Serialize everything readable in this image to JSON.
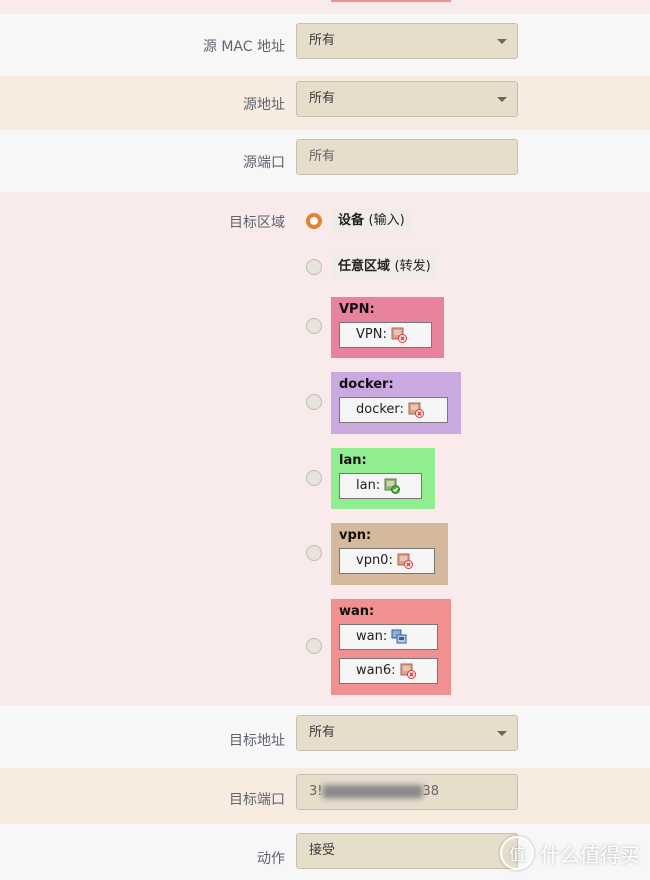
{
  "form": {
    "src_mac": {
      "label": "源 MAC 地址",
      "value": "所有"
    },
    "src_addr": {
      "label": "源地址",
      "value": "所有"
    },
    "src_port": {
      "label": "源端口",
      "placeholder": "所有"
    },
    "dest_zone": {
      "label": "目标区域",
      "device": {
        "name": "设备",
        "sub": "(输入)",
        "checked": true
      },
      "any": {
        "name": "任意区域",
        "sub": "(转发)"
      },
      "zones": [
        {
          "name": "VPN:",
          "color": "#e8839e",
          "ifaces": [
            {
              "name": "VPN:",
              "status": "down"
            }
          ]
        },
        {
          "name": "docker:",
          "color": "#c9a9df",
          "ifaces": [
            {
              "name": "docker:",
              "status": "down"
            }
          ]
        },
        {
          "name": "lan:",
          "color": "#90ee90",
          "ifaces": [
            {
              "name": "lan:",
              "status": "up"
            }
          ]
        },
        {
          "name": "vpn:",
          "color": "#d5b99c",
          "ifaces": [
            {
              "name": "vpn0:",
              "status": "down"
            }
          ]
        },
        {
          "name": "wan:",
          "color": "#f09090",
          "ifaces": [
            {
              "name": "wan:",
              "status": "multi"
            },
            {
              "name": "wan6:",
              "status": "down"
            }
          ]
        }
      ]
    },
    "dest_addr": {
      "label": "目标地址",
      "value": "所有"
    },
    "dest_port": {
      "label": "目标端口",
      "value_start": "3!",
      "value_blur": "▇▇▇▇▇▇▇▇▇▇",
      "value_end": "38"
    },
    "action": {
      "label": "动作",
      "value": "接受"
    }
  },
  "watermark": {
    "text": "什么值得买",
    "logo": "值"
  }
}
